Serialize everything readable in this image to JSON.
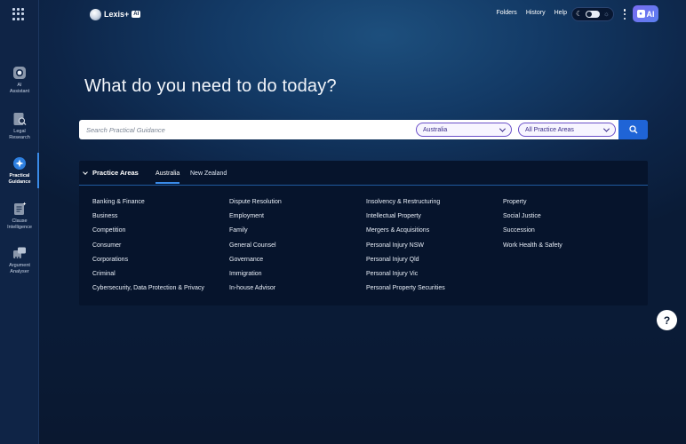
{
  "sidebar": {
    "items": [
      {
        "label": "AI\nAssistant",
        "icon": "ai-assistant-icon",
        "active": false
      },
      {
        "label": "Legal\nResearch",
        "icon": "legal-research-icon",
        "active": false
      },
      {
        "label": "Practical\nGuidance",
        "icon": "practical-guidance-icon",
        "active": true
      },
      {
        "label": "Clause\nIntelligence",
        "icon": "clause-intelligence-icon",
        "active": false
      },
      {
        "label": "Argument\nAnalyser",
        "icon": "argument-analyser-icon",
        "active": false
      }
    ]
  },
  "header": {
    "logo_text": "Lexis+",
    "logo_badge": "AI",
    "nav": [
      "Folders",
      "History",
      "Help"
    ],
    "ai_button": "AI"
  },
  "main": {
    "heading": "What do you need to do today?",
    "search": {
      "placeholder": "Search Practical Guidance",
      "jurisdiction": "Australia",
      "practice_area": "All Practice Areas"
    }
  },
  "practice_panel": {
    "title": "Practice Areas",
    "tabs": [
      "Australia",
      "New Zealand"
    ],
    "active_tab": "Australia",
    "columns": [
      [
        "Banking & Finance",
        "Business",
        "Competition",
        "Consumer",
        "Corporations",
        "Criminal",
        "Cybersecurity, Data Protection & Privacy"
      ],
      [
        "Dispute Resolution",
        "Employment",
        "Family",
        "General Counsel",
        "Governance",
        "Immigration",
        "In-house Advisor"
      ],
      [
        "Insolvency & Restructuring",
        "Intellectual Property",
        "Mergers & Acquisitions",
        "Personal Injury NSW",
        "Personal Injury Qld",
        "Personal Injury Vic",
        "Personal Property Securities"
      ],
      [
        "Property",
        "Social Justice",
        "Succession",
        "Work Health & Safety"
      ]
    ]
  },
  "help_button": "?",
  "colors": {
    "accent": "#1f64d6",
    "tab_underline": "#3a8be8",
    "pill_border": "#6a4fc9"
  }
}
